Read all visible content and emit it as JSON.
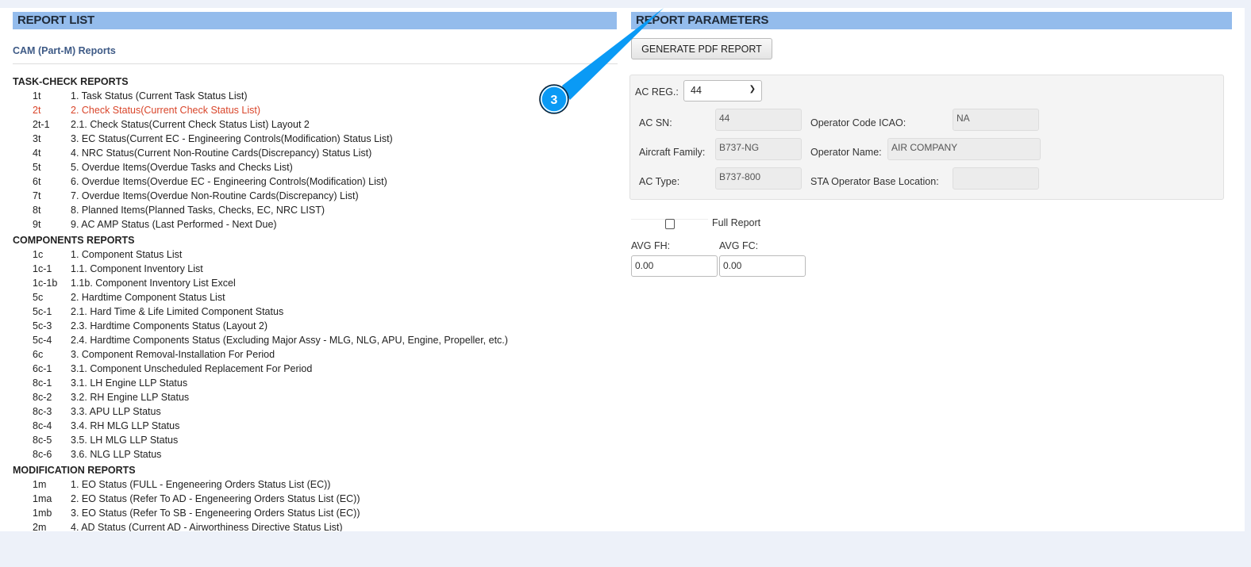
{
  "report_list": {
    "title": "REPORT LIST",
    "category": "CAM (Part-M) Reports",
    "sections": [
      {
        "title": "TASK-CHECK REPORTS",
        "items": [
          {
            "code": "1t",
            "label": "1. Task Status (Current Task Status List)"
          },
          {
            "code": "2t",
            "label": "2. Check Status(Current Check Status List)",
            "active": true
          },
          {
            "code": "2t-1",
            "label": "2.1. Check Status(Current Check Status List) Layout 2"
          },
          {
            "code": "3t",
            "label": "3. EC Status(Current EC - Engineering Controls(Modification) Status List)"
          },
          {
            "code": "4t",
            "label": "4. NRC Status(Current Non-Routine Cards(Discrepancy) Status List)"
          },
          {
            "code": "5t",
            "label": "5. Overdue Items(Overdue Tasks and Checks List)"
          },
          {
            "code": "6t",
            "label": "6. Overdue Items(Overdue EC - Engineering Controls(Modification) List)"
          },
          {
            "code": "7t",
            "label": "7. Overdue Items(Overdue Non-Routine Cards(Discrepancy) List)"
          },
          {
            "code": "8t",
            "label": "8. Planned Items(Planned Tasks, Checks, EC, NRC LIST)"
          },
          {
            "code": "9t",
            "label": "9. AC AMP Status (Last Performed - Next Due)"
          }
        ]
      },
      {
        "title": "COMPONENTS REPORTS",
        "items": [
          {
            "code": "1c",
            "label": "1. Component Status List"
          },
          {
            "code": "1c-1",
            "label": "1.1. Component Inventory List"
          },
          {
            "code": "1c-1b",
            "label": "1.1b. Component Inventory List Excel"
          },
          {
            "code": "5c",
            "label": "2. Hardtime Component Status List"
          },
          {
            "code": "5c-1",
            "label": "2.1. Hard Time & Life Limited Component Status"
          },
          {
            "code": "5c-3",
            "label": "2.3. Hardtime Components Status (Layout 2)"
          },
          {
            "code": "5c-4",
            "label": "2.4. Hardtime Components Status (Excluding Major Assy - MLG, NLG, APU, Engine, Propeller, etc.)"
          },
          {
            "code": "6c",
            "label": "3. Component Removal-Installation For Period"
          },
          {
            "code": "6c-1",
            "label": "3.1. Component Unscheduled Replacement For Period"
          },
          {
            "code": "8c-1",
            "label": "3.1. LH Engine LLP Status"
          },
          {
            "code": "8c-2",
            "label": "3.2. RH Engine LLP Status"
          },
          {
            "code": "8c-3",
            "label": "3.3. APU LLP Status"
          },
          {
            "code": "8c-4",
            "label": "3.4. RH MLG LLP Status"
          },
          {
            "code": "8c-5",
            "label": "3.5. LH MLG LLP Status"
          },
          {
            "code": "8c-6",
            "label": "3.6. NLG LLP Status"
          }
        ]
      },
      {
        "title": "MODIFICATION REPORTS",
        "items": [
          {
            "code": "1m",
            "label": "1. EO Status (FULL - Engeneering Orders Status List (EC))"
          },
          {
            "code": "1ma",
            "label": "2. EO Status (Refer To AD - Engeneering Orders Status List (EC))"
          },
          {
            "code": "1mb",
            "label": "3. EO Status (Refer To SB - Engeneering Orders Status List (EC))"
          },
          {
            "code": "2m",
            "label": "4. AD Status (Current AD - Airworthiness Directive Status List)"
          }
        ]
      }
    ]
  },
  "params": {
    "title": "REPORT PARAMETERS",
    "generate_label": "GENERATE PDF REPORT",
    "ac_reg_label": "AC REG.:",
    "ac_reg_value": "44",
    "ac_sn_label": "AC SN:",
    "ac_sn": "44",
    "family_label": "Aircraft Family:",
    "family": "B737-NG",
    "type_label": "AC Type:",
    "type": "B737-800",
    "icao_label": "Operator Code ICAO:",
    "icao": "NA",
    "opname_label": "Operator Name:",
    "opname": "AIR COMPANY",
    "base_label": "STA Operator Base Location:",
    "base": "",
    "full_report_label": "Full Report",
    "avg_fh_label": "AVG FH:",
    "avg_fh": "0.00",
    "avg_fc_label": "AVG FC:",
    "avg_fc": "0.00"
  },
  "callout": {
    "number": "3",
    "color": "#0a9af5"
  }
}
